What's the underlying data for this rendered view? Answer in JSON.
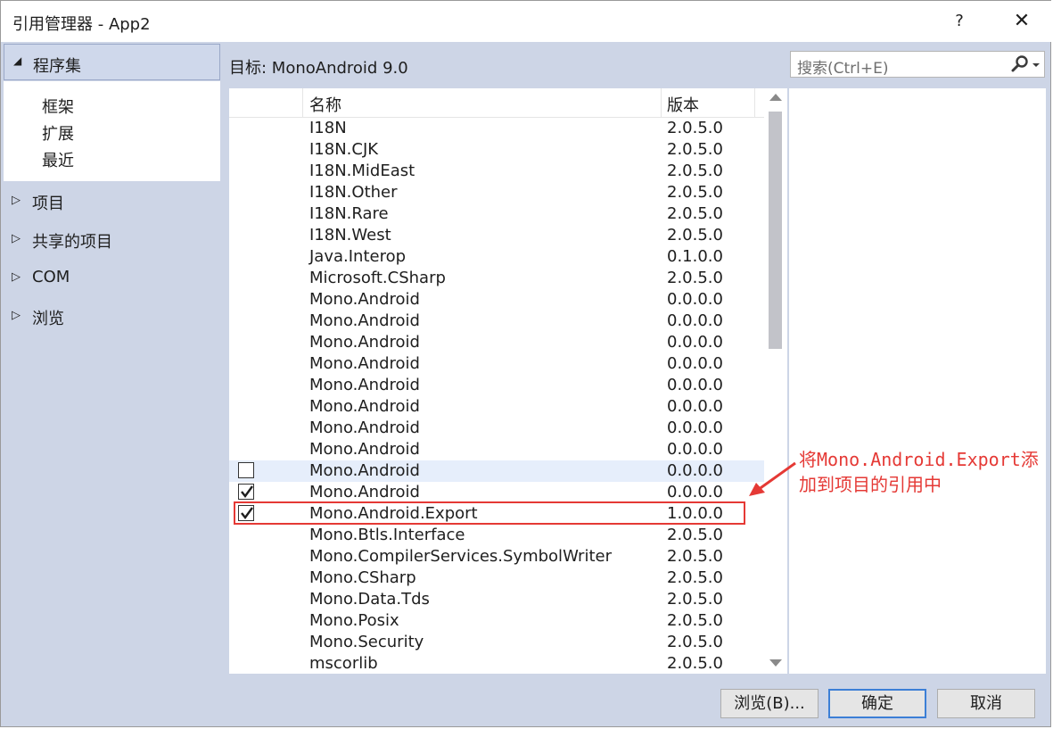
{
  "window": {
    "title": "引用管理器 - App2",
    "help_label": "?",
    "close_label": "✕"
  },
  "sidebar": {
    "header": {
      "label": "程序集",
      "arrow": "◢"
    },
    "subitems": [
      "框架",
      "扩展",
      "最近"
    ],
    "items": [
      {
        "label": "项目",
        "arrow": "▷"
      },
      {
        "label": "共享的项目",
        "arrow": "▷"
      },
      {
        "label": "COM",
        "arrow": "▷"
      },
      {
        "label": "浏览",
        "arrow": "▷"
      }
    ]
  },
  "target": "目标: MonoAndroid 9.0",
  "search": {
    "placeholder": "搜索(Ctrl+E)",
    "icon": "search-icon"
  },
  "list": {
    "headers": {
      "name": "名称",
      "version": "版本"
    },
    "rows": [
      {
        "name": "I18N",
        "version": "2.0.5.0"
      },
      {
        "name": "I18N.CJK",
        "version": "2.0.5.0"
      },
      {
        "name": "I18N.MidEast",
        "version": "2.0.5.0"
      },
      {
        "name": "I18N.Other",
        "version": "2.0.5.0"
      },
      {
        "name": "I18N.Rare",
        "version": "2.0.5.0"
      },
      {
        "name": "I18N.West",
        "version": "2.0.5.0"
      },
      {
        "name": "Java.Interop",
        "version": "0.1.0.0"
      },
      {
        "name": "Microsoft.CSharp",
        "version": "2.0.5.0"
      },
      {
        "name": "Mono.Android",
        "version": "0.0.0.0"
      },
      {
        "name": "Mono.Android",
        "version": "0.0.0.0"
      },
      {
        "name": "Mono.Android",
        "version": "0.0.0.0"
      },
      {
        "name": "Mono.Android",
        "version": "0.0.0.0"
      },
      {
        "name": "Mono.Android",
        "version": "0.0.0.0"
      },
      {
        "name": "Mono.Android",
        "version": "0.0.0.0"
      },
      {
        "name": "Mono.Android",
        "version": "0.0.0.0"
      },
      {
        "name": "Mono.Android",
        "version": "0.0.0.0"
      },
      {
        "name": "Mono.Android",
        "version": "0.0.0.0",
        "checkbox": "unchecked",
        "highlighted": true
      },
      {
        "name": "Mono.Android",
        "version": "0.0.0.0",
        "checkbox": "checked"
      },
      {
        "name": "Mono.Android.Export",
        "version": "1.0.0.0",
        "checkbox": "checked"
      },
      {
        "name": "Mono.Btls.Interface",
        "version": "2.0.5.0"
      },
      {
        "name": "Mono.CompilerServices.SymbolWriter",
        "version": "2.0.5.0"
      },
      {
        "name": "Mono.CSharp",
        "version": "2.0.5.0"
      },
      {
        "name": "Mono.Data.Tds",
        "version": "2.0.5.0"
      },
      {
        "name": "Mono.Posix",
        "version": "2.0.5.0"
      },
      {
        "name": "Mono.Security",
        "version": "2.0.5.0"
      },
      {
        "name": "mscorlib",
        "version": "2.0.5.0"
      }
    ]
  },
  "annotation": {
    "line1": "将Mono.Android.Export添",
    "line2": "加到项目的引用中",
    "color": "#e53935"
  },
  "buttons": {
    "browse": "浏览(B)...",
    "ok": "确定",
    "cancel": "取消"
  },
  "colors": {
    "chrome": "#cdd5e6",
    "selected_row": "#e6eefb",
    "ok_border": "#3c7fd6"
  }
}
